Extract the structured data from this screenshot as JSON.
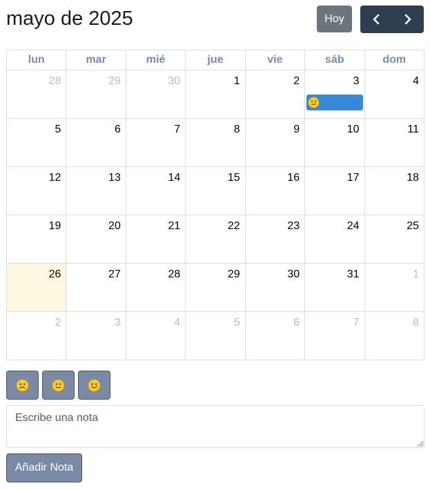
{
  "calendar": {
    "title": "mayo de 2025",
    "today_label": "Hoy",
    "weekdays": [
      "lun",
      "mar",
      "mié",
      "jue",
      "vie",
      "sáb",
      "dom"
    ],
    "weeks": [
      [
        "28",
        "29",
        "30",
        "1",
        "2",
        "3",
        "4"
      ],
      [
        "5",
        "6",
        "7",
        "8",
        "9",
        "10",
        "11"
      ],
      [
        "12",
        "13",
        "14",
        "15",
        "16",
        "17",
        "18"
      ],
      [
        "19",
        "20",
        "21",
        "22",
        "23",
        "24",
        "25"
      ],
      [
        "26",
        "27",
        "28",
        "29",
        "30",
        "31",
        "1"
      ],
      [
        "2",
        "3",
        "4",
        "5",
        "6",
        "7",
        "8"
      ]
    ],
    "other_month": [
      [
        true,
        true,
        true,
        false,
        false,
        false,
        false
      ],
      [
        false,
        false,
        false,
        false,
        false,
        false,
        false
      ],
      [
        false,
        false,
        false,
        false,
        false,
        false,
        false
      ],
      [
        false,
        false,
        false,
        false,
        false,
        false,
        false
      ],
      [
        false,
        false,
        false,
        false,
        false,
        false,
        true
      ],
      [
        true,
        true,
        true,
        true,
        true,
        true,
        true
      ]
    ],
    "highlighted_day": {
      "week": 4,
      "day": 0
    },
    "events": [
      {
        "week": 0,
        "day": 5,
        "mood": "neutral-face-icon"
      }
    ]
  },
  "moods": [
    {
      "name": "sad-face-icon"
    },
    {
      "name": "neutral-face-icon"
    },
    {
      "name": "happy-face-icon"
    }
  ],
  "note": {
    "placeholder": "Escribe una nota"
  },
  "add_note_label": "Añadir Nota",
  "colors": {
    "nav_dark": "#2c3e50",
    "today_button": "#6c757d",
    "event_blue": "#3788d8",
    "mood_button": "#7a8aa5",
    "today_highlight": "#fff8e1"
  }
}
